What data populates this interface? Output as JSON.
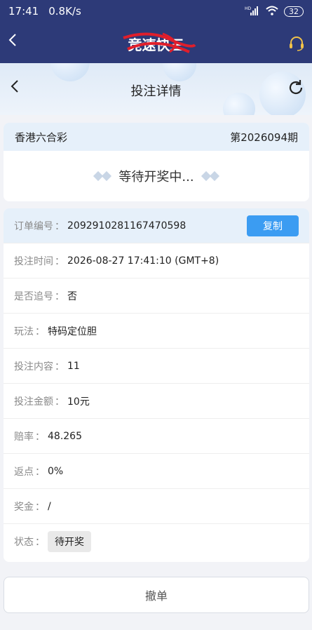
{
  "status_bar": {
    "time": "17:41",
    "net_speed": "0.8K/s",
    "signal": "HD",
    "battery": "32"
  },
  "app_bar": {
    "title": "竞速快三",
    "back_icon": "chevron-left-icon",
    "support_icon": "headset-icon"
  },
  "detail_header": {
    "title": "投注详情",
    "back_icon": "chevron-left-icon",
    "refresh_icon": "refresh-icon"
  },
  "lottery": {
    "name": "香港六合彩",
    "issue": "第2026094期",
    "status_text": "等待开奖中..."
  },
  "order": {
    "rows": [
      {
        "label": "订单编号",
        "value": "2092910281167470598"
      },
      {
        "label": "投注时间",
        "value": "2026-08-27 17:41:10 (GMT+8)"
      },
      {
        "label": "是否追号",
        "value": "否"
      },
      {
        "label": "玩法",
        "value": "特码定位胆"
      },
      {
        "label": "投注内容",
        "value": "11"
      },
      {
        "label": "投注金额",
        "value": "10元"
      },
      {
        "label": "赔率",
        "value": "48.265"
      },
      {
        "label": "返点",
        "value": "0%"
      },
      {
        "label": "奖金",
        "value": "/"
      }
    ],
    "status_label": "状态",
    "status_value": "待开奖",
    "copy_label": "复制",
    "colon": "："
  },
  "cancel_label": "撤单",
  "colors": {
    "app_bar_bg": "#2d3a78",
    "accent": "#3b9cf2",
    "page_bg": "#f2f3f7"
  }
}
